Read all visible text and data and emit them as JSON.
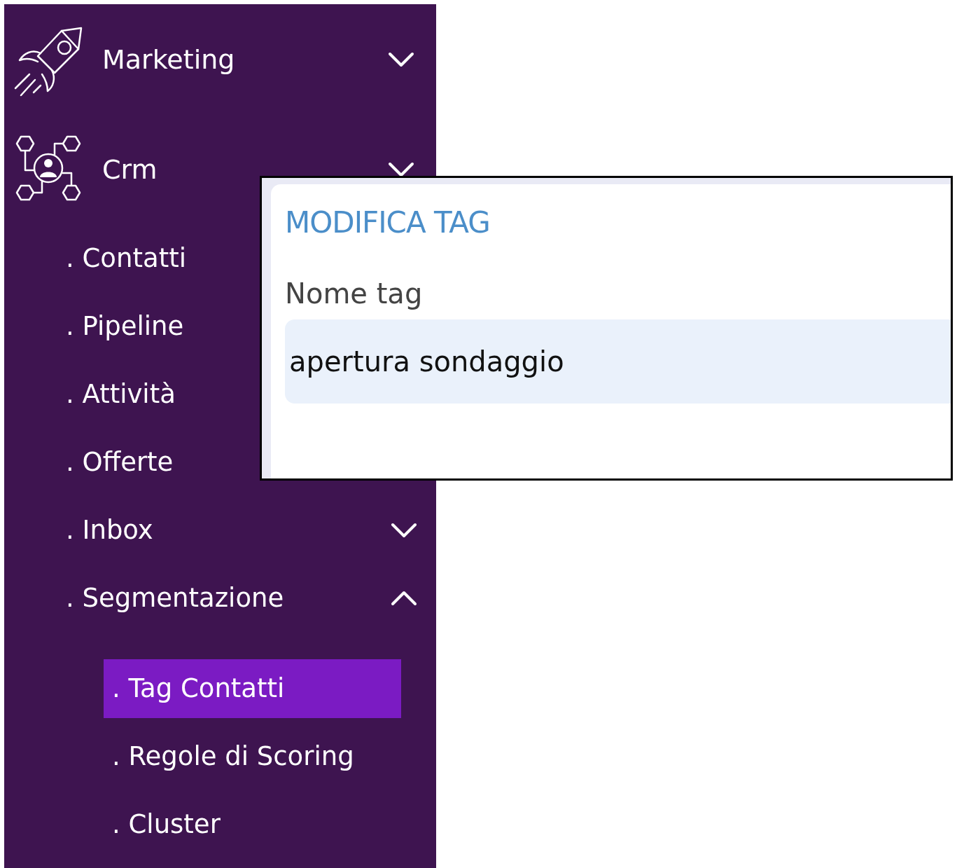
{
  "sidebar": {
    "items": [
      {
        "label": "Marketing",
        "expanded": false,
        "selected": false
      },
      {
        "label": "Crm",
        "expanded": false,
        "selected": false,
        "children": [
          {
            "label": ". Contatti",
            "selected": false
          },
          {
            "label": ". Pipeline",
            "selected": false
          },
          {
            "label": ". Attività",
            "selected": false
          },
          {
            "label": ". Offerte",
            "selected": false
          },
          {
            "label": ". Inbox",
            "expanded": false,
            "selected": false
          },
          {
            "label": ". Segmentazione",
            "expanded": true,
            "selected": false,
            "children": [
              {
                "label": ". Tag Contatti",
                "selected": true
              },
              {
                "label": ". Regole di Scoring",
                "selected": false
              },
              {
                "label": ". Cluster",
                "selected": false
              }
            ]
          }
        ]
      }
    ]
  },
  "dialog": {
    "title": "MODIFICA TAG",
    "field": {
      "label": "Nome tag",
      "value": "apertura sondaggio"
    }
  }
}
